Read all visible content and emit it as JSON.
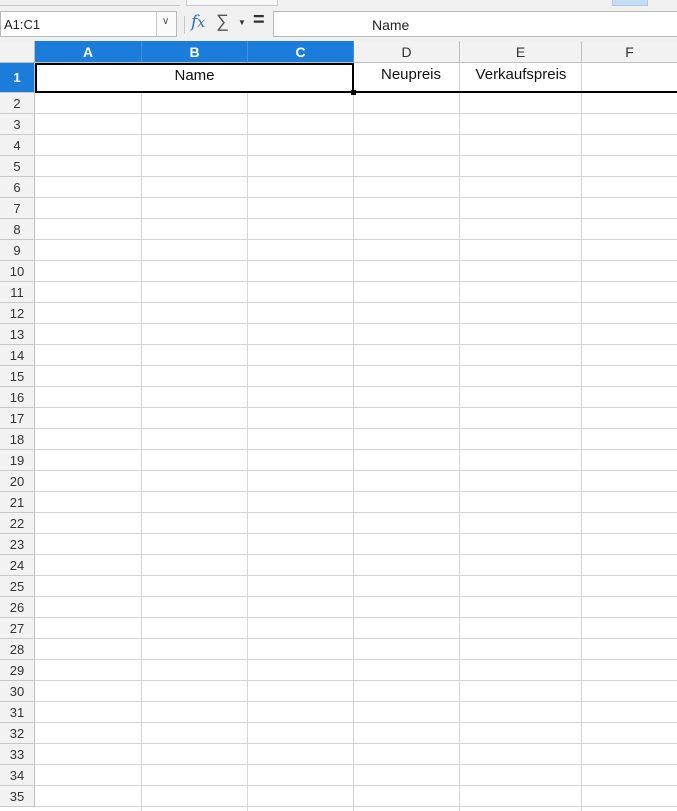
{
  "formula_bar": {
    "name_box": "A1:C1",
    "fx_icon": "function-wizard-icon",
    "sum_icon": "sigma-icon",
    "equals": "=",
    "formula": "Name"
  },
  "columns": [
    "A",
    "B",
    "C",
    "D",
    "E",
    "F"
  ],
  "selected_columns": [
    "A",
    "B",
    "C"
  ],
  "rows": [
    "1",
    "2",
    "3",
    "4",
    "5",
    "6",
    "7",
    "8",
    "9",
    "10",
    "11",
    "12",
    "13",
    "14",
    "15",
    "16",
    "17",
    "18",
    "19",
    "20",
    "21",
    "22",
    "23",
    "24",
    "25",
    "26",
    "27",
    "28",
    "29",
    "30",
    "31",
    "32",
    "33",
    "34",
    "35"
  ],
  "cells": {
    "A1": "Name",
    "D1": "Neupreis",
    "E1": "Verkaufspreis"
  },
  "colors": {
    "selection_header": "#1b7cd9",
    "fx_blue": "#2a6fc8"
  }
}
